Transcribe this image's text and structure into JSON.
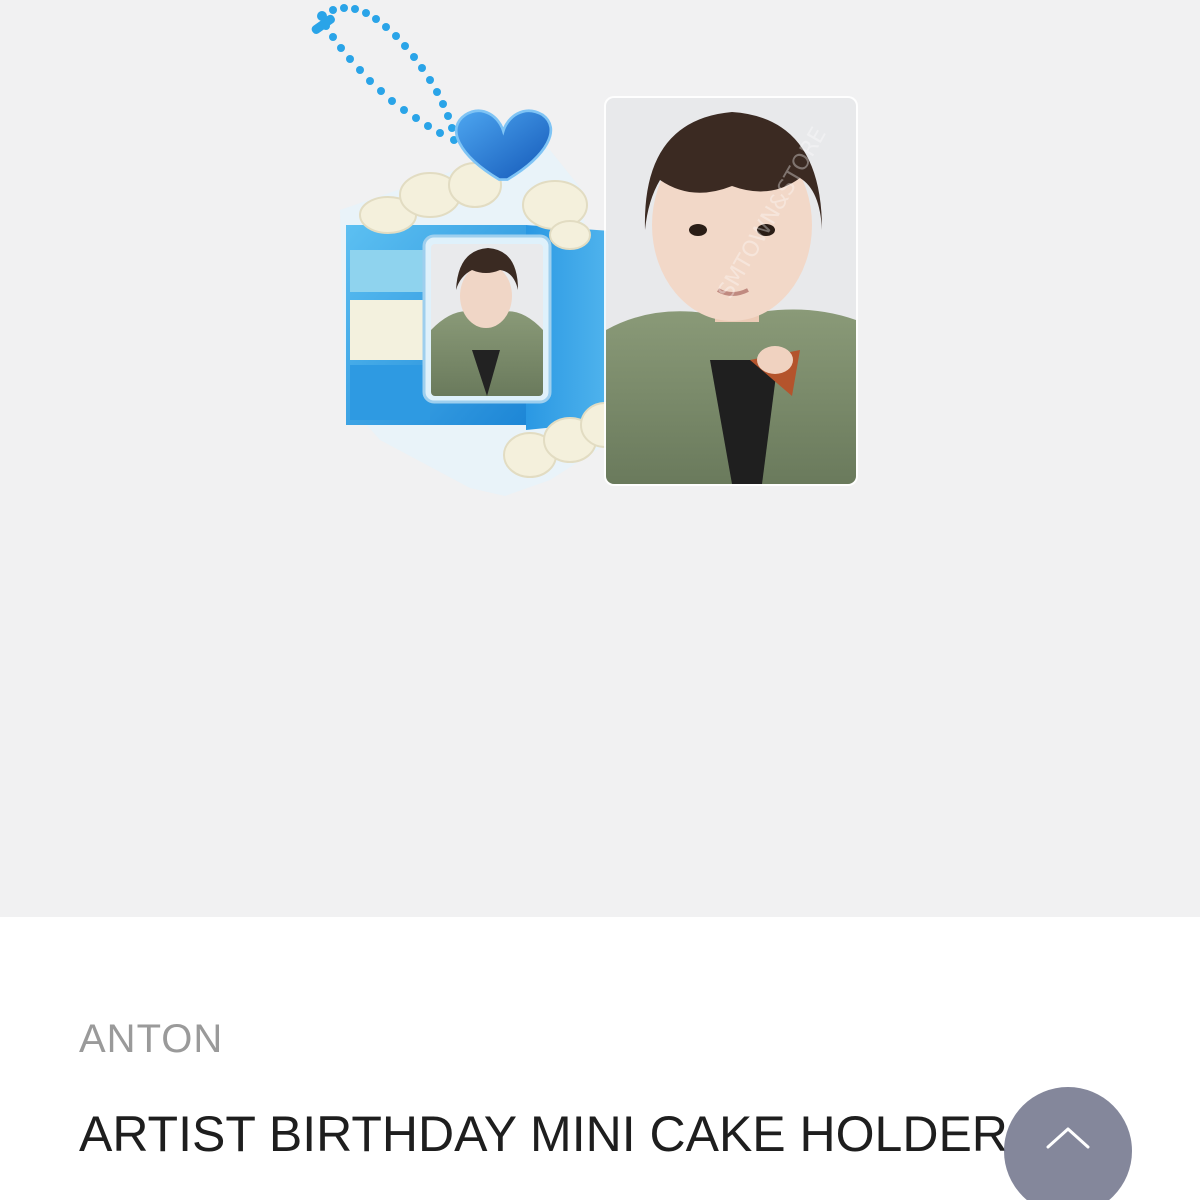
{
  "product": {
    "brand": "ANTON",
    "title": "ARTIST BIRTHDAY MINI CAKE HOLDER",
    "image_alt": "Blue mini cake photo holder keyring with photocard"
  },
  "watermark": {
    "text": "SMTOWN&STORE"
  },
  "icons": {
    "scroll_top": "chevron-up-icon"
  },
  "colors": {
    "image_background": "#f1f1f2",
    "cake_blue": "#2f9be0",
    "brand_gray": "#9a9a9a",
    "title_dark": "#1e1e1e",
    "fab_bg": "#6e728a"
  }
}
